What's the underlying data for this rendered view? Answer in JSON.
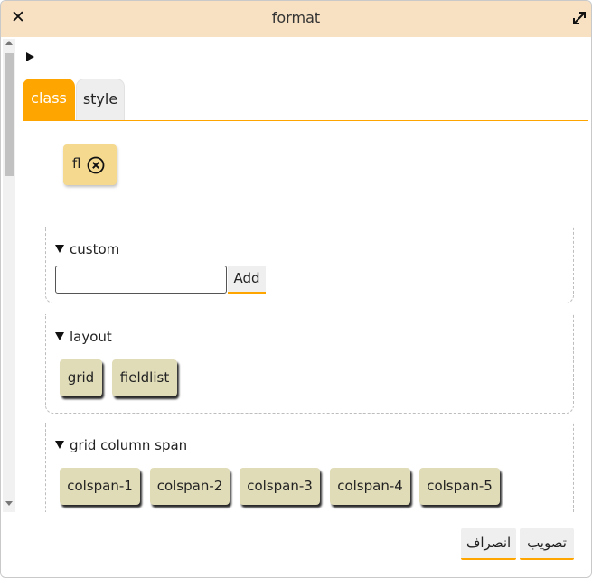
{
  "dialog": {
    "title": "format"
  },
  "tabs": [
    {
      "label": "class",
      "active": true
    },
    {
      "label": "style",
      "active": false
    }
  ],
  "selected_classes": [
    {
      "label": "fl"
    }
  ],
  "sections": {
    "custom": {
      "header": "custom",
      "input_value": "",
      "add_label": "Add"
    },
    "layout": {
      "header": "layout",
      "options": [
        "grid",
        "fieldlist"
      ]
    },
    "grid_column_span": {
      "header": "grid column span",
      "options": [
        "colspan-1",
        "colspan-2",
        "colspan-3",
        "colspan-4",
        "colspan-5"
      ]
    }
  },
  "footer": {
    "cancel_label": "انصراف",
    "approve_label": "تصویب"
  },
  "colors": {
    "titlebar": "#f8e1c3",
    "accent": "#ffa500",
    "chip": "#f5d98f",
    "option": "#e0dcb8"
  },
  "icons": {
    "close": "close-icon",
    "expand": "expand-icon",
    "remove": "remove-circle-icon"
  }
}
